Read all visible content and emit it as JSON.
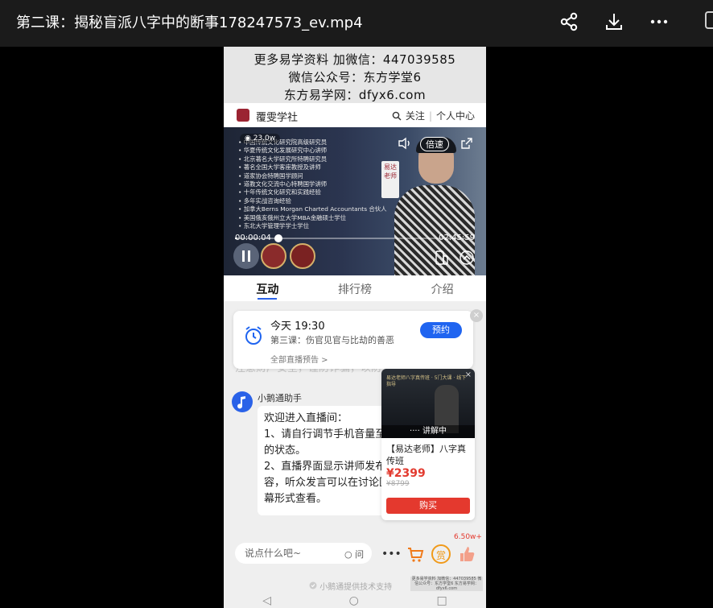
{
  "window": {
    "title": "第二课：揭秘盲派八字中的断事178247573_ev.mp4",
    "icons": [
      "share-icon",
      "download-icon",
      "more-icon"
    ]
  },
  "watermark": {
    "line1": "更多易学资料 加微信：447039585",
    "line2": "微信公众号：东方学堂6",
    "line3": "东方易学网：dfyx6.com"
  },
  "brand": {
    "name": "覆雯学社",
    "follow": "关注",
    "separator": "|",
    "profile": "个人中心"
  },
  "video": {
    "views": "23.0w",
    "speed_label": "倍速",
    "current_time": "00:00:04",
    "duration": "02:45:59",
    "progress_fraction": 0.01,
    "seal_text": "易达老师",
    "slide_lines": [
      "• 中国传统文化研究院高级研究员",
      "• 华夏传统文化发展研究中心讲师",
      "• 北京著名大学研究所特聘研究员",
      "• 著名全国大学客座教授及讲师",
      "• 道家协会特聘国学顾问",
      "• 道教文化交流中心特聘国学讲师",
      "• 十年传统文化研究和实践经验",
      "• 多年实战咨询经验",
      "• 加拿大Berns Morgan Charted Accountants 合伙人",
      "• 美国俄亥俄州立大学MBA金融硕士学位",
      "• 东北大学管理学学士学位"
    ]
  },
  "tabs": [
    {
      "label": "互动",
      "active": true
    },
    {
      "label": "排行榜",
      "active": false
    },
    {
      "label": "介绍",
      "active": false
    }
  ],
  "reminder": {
    "time": "今天 19:30",
    "subtitle": "第三课：伤官见官与比劫的善恶",
    "button": "预约",
    "link": "全部直播预告 >",
    "close": "×"
  },
  "ghost_text": "注意财产安全，谨防诈骗，以防入骗。",
  "assistant": {
    "name": "小鹅通助手",
    "message_lines": [
      "欢迎进入直播间：",
      "1、请自行调节手机音量至合适的状态。",
      "2、直播界面显示讲师发布的内容，听众发言可以在讨论区以弹幕形式查看。"
    ]
  },
  "product": {
    "thumb_text": "易达老师八字真传班 · 5门大课 · 线下指导",
    "tag": "···· 讲解中",
    "name": "【易达老师】八字真传班",
    "price": "¥2399",
    "original_price": "¥8799",
    "buy": "购买",
    "close": "×"
  },
  "input": {
    "placeholder": "说点什么吧~",
    "ask_label": "问",
    "reward_label": "赏",
    "likes": "6.50w+"
  },
  "support": "小鹅通提供技术支持",
  "qr_text": "更多易学资料 加微信：447039585 微信公众号：东方学堂6 东方易学网：dfyx6.com",
  "navbar": [
    "◁",
    "○",
    "□"
  ]
}
